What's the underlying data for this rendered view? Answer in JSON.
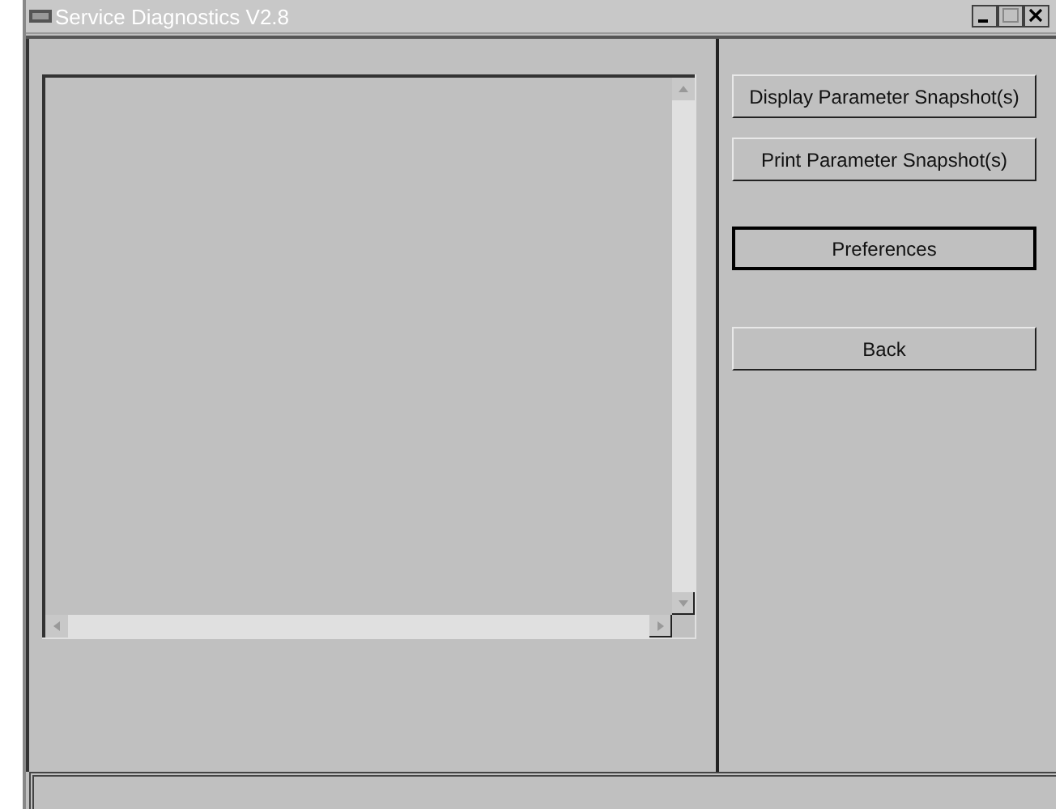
{
  "window": {
    "title": "Service Diagnostics  V2.8"
  },
  "buttons": [
    {
      "label": "Display Parameter Snapshot(s)",
      "focused": false
    },
    {
      "label": "Print Parameter Snapshot(s)",
      "focused": false
    },
    {
      "label": "Preferences",
      "focused": true
    },
    {
      "label": "Back",
      "focused": false
    }
  ]
}
